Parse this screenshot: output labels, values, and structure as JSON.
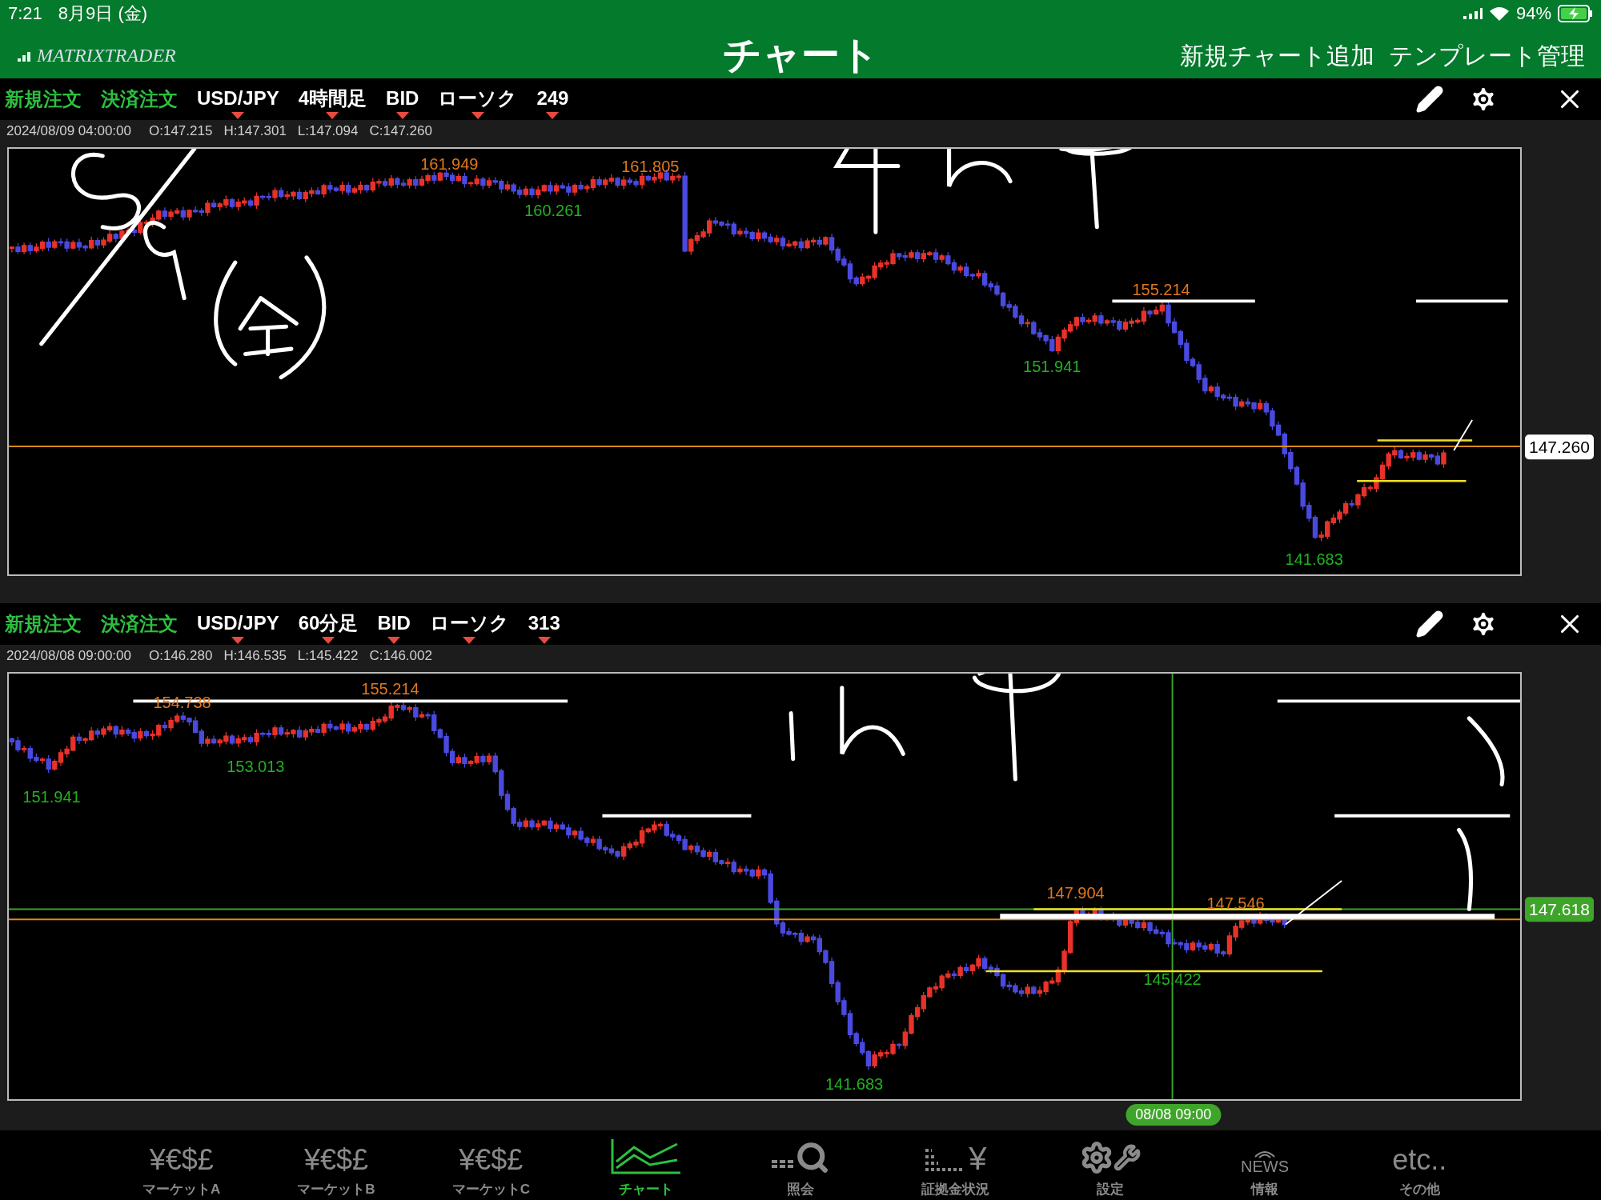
{
  "status_bar": {
    "time": "7:21",
    "date": "8月9日 (金)",
    "battery": "94%"
  },
  "header": {
    "logo": "MATRIXTRADER",
    "title": "チャート",
    "actions": [
      "新規チャート追加",
      "テンプレート管理"
    ]
  },
  "charts": [
    {
      "order_buttons": [
        "新規注文",
        "決済注文"
      ],
      "selectors": [
        "USD/JPY",
        "4時間足",
        "BID",
        "ローソク",
        "249"
      ],
      "info": [
        "2024/08/09 04:00:00",
        "O:147.215",
        "H:147.301",
        "L:147.094",
        "C:147.260"
      ],
      "price_labels": [
        {
          "text": "161.949",
          "kind": "high"
        },
        {
          "text": "161.805",
          "kind": "high"
        },
        {
          "text": "160.261",
          "kind": "low"
        },
        {
          "text": "155.214",
          "kind": "high"
        },
        {
          "text": "151.941",
          "kind": "low"
        },
        {
          "text": "141.683",
          "kind": "low"
        }
      ],
      "price_tag": {
        "text": "147.260",
        "kind": "current"
      }
    },
    {
      "order_buttons": [
        "新規注文",
        "決済注文"
      ],
      "selectors": [
        "USD/JPY",
        "60分足",
        "BID",
        "ローソク",
        "313"
      ],
      "info": [
        "2024/08/08 09:00:00",
        "O:146.280",
        "H:146.535",
        "L:145.422",
        "C:146.002"
      ],
      "price_labels": [
        {
          "text": "154.738",
          "kind": "high"
        },
        {
          "text": "155.214",
          "kind": "high"
        },
        {
          "text": "153.013",
          "kind": "low"
        },
        {
          "text": "151.941",
          "kind": "low"
        },
        {
          "text": "141.683",
          "kind": "low"
        },
        {
          "text": "147.904",
          "kind": "high"
        },
        {
          "text": "147.546",
          "kind": "high"
        },
        {
          "text": "145.422",
          "kind": "low"
        }
      ],
      "price_tag": {
        "text": "147.618",
        "kind": "crosshair"
      },
      "time_tag": "08/08 09:00"
    }
  ],
  "tab_bar": [
    {
      "label": "マーケットA",
      "icon_text": "¥€$£",
      "kind": "text",
      "selected": false
    },
    {
      "label": "マーケットB",
      "icon_text": "¥€$£",
      "kind": "text",
      "selected": false
    },
    {
      "label": "マーケットC",
      "icon_text": "¥€$£",
      "kind": "text",
      "selected": false
    },
    {
      "label": "チャート",
      "kind": "chart",
      "selected": true
    },
    {
      "label": "照会",
      "kind": "search",
      "selected": false
    },
    {
      "label": "証拠金状況",
      "icon_text": "¥",
      "kind": "bars-yen",
      "selected": false
    },
    {
      "label": "設定",
      "kind": "tools",
      "selected": false
    },
    {
      "label": "情報",
      "icon_text": "NEWS",
      "kind": "news",
      "selected": false
    },
    {
      "label": "その他",
      "icon_text": "etc..",
      "kind": "text",
      "selected": false
    }
  ]
}
